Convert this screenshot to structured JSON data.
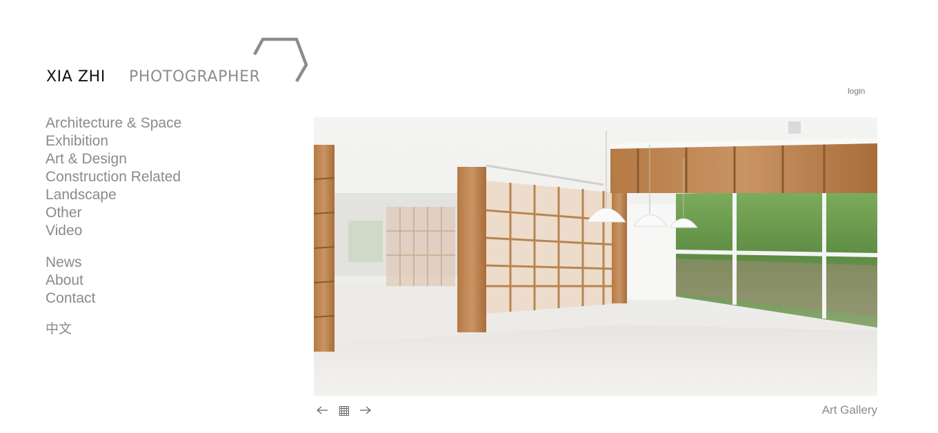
{
  "header": {
    "logo_name": "XIA ZHI",
    "logo_role": "PHOTOGRAPHER",
    "login_label": "login"
  },
  "nav": {
    "categories": [
      "Architecture & Space",
      "Exhibition",
      "Art & Design",
      "Construction Related",
      "Landscape",
      "Other",
      "Video"
    ],
    "info": [
      "News",
      "About",
      "Contact"
    ],
    "language": "中文"
  },
  "gallery": {
    "caption": "Art Gallery",
    "prev_icon": "left-arrow-icon",
    "grid_icon": "grid-icon",
    "next_icon": "right-arrow-icon"
  },
  "colors": {
    "text_gray": "#8a8a8a",
    "logo_black": "#111111",
    "background": "#ffffff"
  }
}
